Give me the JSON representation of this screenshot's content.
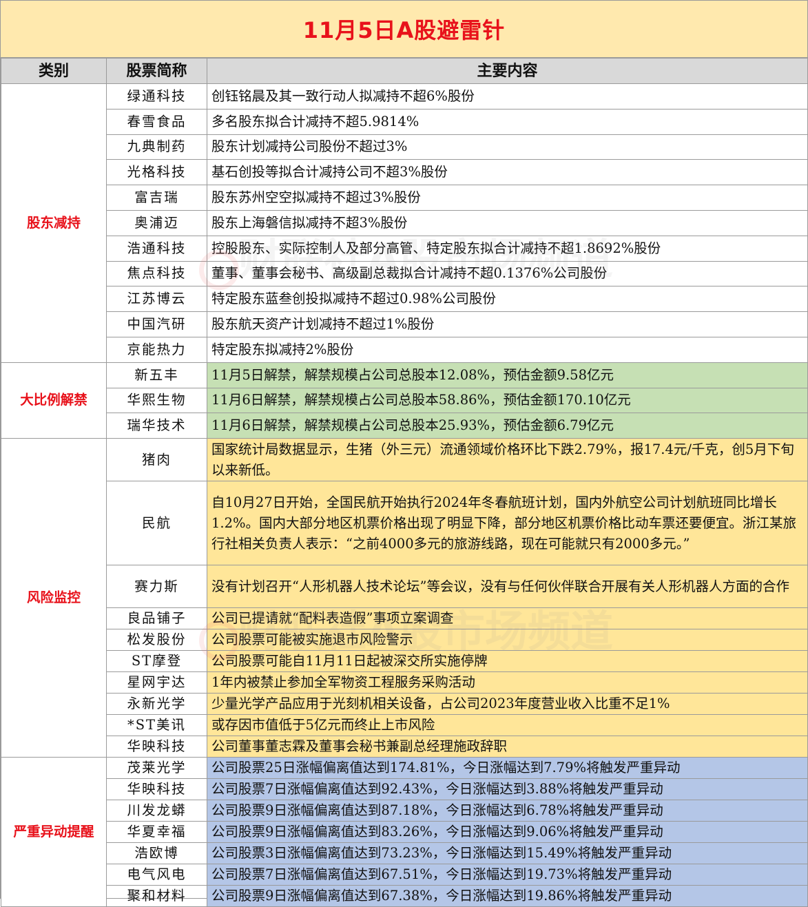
{
  "title": "11月5日A股避雷针",
  "header": {
    "category": "类别",
    "stock": "股票简称",
    "content": "主要内容"
  },
  "colors": {
    "title_bg": "#FFE9AE",
    "title_text": "#E8121B",
    "category_text": "#E8121B",
    "header_bg": "#D9D9D9",
    "green_row": "#C6E0B4",
    "yellow_row": "#FFE699",
    "blue_row": "#B4C6E7"
  },
  "groups": [
    {
      "category": "股东减持",
      "bg": "white",
      "rows": [
        {
          "name": "绿通科技",
          "content": "创钰铭晨及其一致行动人拟减持不超6%股份"
        },
        {
          "name": "春雪食品",
          "content": "多名股东拟合计减持不超5.9814%"
        },
        {
          "name": "九典制药",
          "content": "股东计划减持公司股份不超过3%"
        },
        {
          "name": "光格科技",
          "content": "基石创投等拟合计减持公司不超3%股份"
        },
        {
          "name": "富吉瑞",
          "content": "股东苏州空空拟减持不超过3%股份"
        },
        {
          "name": "奥浦迈",
          "content": "股东上海磐信拟减持不超3%股份"
        },
        {
          "name": "浩通科技",
          "content": "控股股东、实际控制人及部分高管、特定股东拟合计减持不超1.8692%股份"
        },
        {
          "name": "焦点科技",
          "content": "董事、董事会秘书、高级副总裁拟合计减持不超0.1376%公司股份"
        },
        {
          "name": "江苏博云",
          "content": "特定股东蓝叁创投拟减持不超过0.98%公司股份"
        },
        {
          "name": "中国汽研",
          "content": "股东航天资产计划减持不超过1%股份"
        },
        {
          "name": "京能热力",
          "content": "特定股东拟减持2%股份"
        }
      ]
    },
    {
      "category": "大比例解禁",
      "bg": "green",
      "rows": [
        {
          "name": "新五丰",
          "content": "11月5日解禁，解禁规模占公司总股本12.08%，预估金额9.58亿元"
        },
        {
          "name": "华熙生物",
          "content": "11月6日解禁，解禁规模占公司总股本58.86%，预估金额170.10亿元"
        },
        {
          "name": "瑞华技术",
          "content": "11月6日解禁，解禁规模占公司总股本25.93%，预估金额6.79亿元"
        }
      ]
    },
    {
      "category": "风险监控",
      "bg": "yellow",
      "rows": [
        {
          "name": "猪肉",
          "content": "国家统计局数据显示，生猪（外三元）流通领域价格环比下跌2.79%，报17.4元/千克，创5月下旬以来新低。",
          "lines": 2
        },
        {
          "name": "民航",
          "content": "自10月27日开始，全国民航开始执行2024年冬春航班计划，国内外航空公司计划航班同比增长1.2%。国内大部分地区机票价格出现了明显下降，部分地区机票价格比动车票还要便宜。浙江某旅行社相关负责人表示：“之前4000多元的旅游线路，现在可能就只有2000多元。”",
          "lines": 4
        },
        {
          "name": "赛力斯",
          "content": "没有计划召开“人形机器人技术论坛”等会议，没有与任何伙伴联合开展有关人形机器人方面的合作",
          "lines": 2
        },
        {
          "name": "良品铺子",
          "content": "公司已提请就“配料表造假”事项立案调查"
        },
        {
          "name": "松发股份",
          "content": "公司股票可能被实施退市风险警示"
        },
        {
          "name": "ST摩登",
          "content": "公司股票可能自11月11日起被深交所实施停牌"
        },
        {
          "name": "星网宇达",
          "content": "1年内被禁止参加全军物资工程服务采购活动"
        },
        {
          "name": "永新光学",
          "content": "少量光学产品应用于光刻机相关设备，占公司2023年度营业收入比重不足1%"
        },
        {
          "name": "*ST美讯",
          "content": "或存因市值低于5亿元而终止上市风险"
        },
        {
          "name": "华映科技",
          "content": "公司董事董志霖及董事会秘书兼副总经理施政辞职"
        }
      ]
    },
    {
      "category": "严重异动提醒",
      "bg": "blue",
      "rows": [
        {
          "name": "茂莱光学",
          "content": "公司股票25日涨幅偏离值达到174.81%，今日涨幅达到7.79%将触发严重异动"
        },
        {
          "name": "华映科技",
          "content": "公司股票7日涨幅偏离值达到92.43%，今日涨幅达到3.88%将触发严重异动"
        },
        {
          "name": "川发龙蟒",
          "content": "公司股票9日涨幅偏离值达到87.18%，今日涨幅达到6.78%将触发严重异动"
        },
        {
          "name": "华夏幸福",
          "content": "公司股票9日涨幅偏离值达到83.26%，今日涨幅达到9.06%将触发严重异动"
        },
        {
          "name": "浩欧博",
          "content": "公司股票3日涨幅偏离值达到73.23%，今日涨幅达到15.49%将触发严重异动"
        },
        {
          "name": "电气风电",
          "content": "公司股票7日涨幅偏离值达到67.51%，今日涨幅达到19.73%将触发严重异动"
        },
        {
          "name": "聚和材料",
          "content": "公司股票9日涨幅偏离值达到67.38%，今日涨幅达到19.86%将触发严重异动"
        }
      ]
    }
  ],
  "watermark": {
    "text": "财联社A股市场频道"
  }
}
